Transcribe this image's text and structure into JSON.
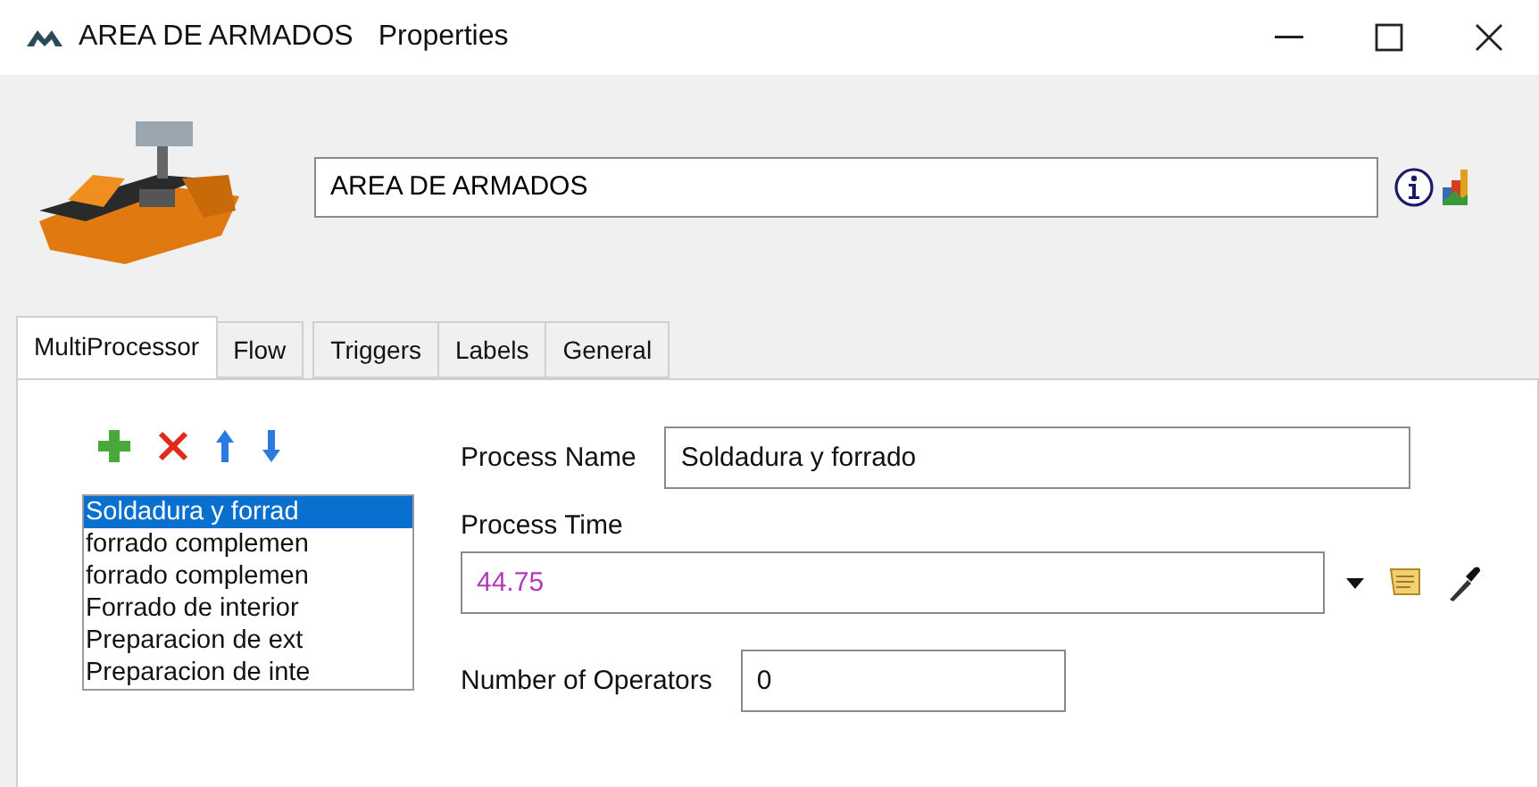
{
  "window": {
    "title": "AREA DE ARMADOS",
    "subtitle": "Properties"
  },
  "object_name": "AREA DE ARMADOS",
  "tabs": [
    {
      "label": "MultiProcessor",
      "selected": true
    },
    {
      "label": "Flow",
      "selected": false
    },
    {
      "label": "Triggers",
      "selected": false
    },
    {
      "label": "Labels",
      "selected": false
    },
    {
      "label": "General",
      "selected": false
    }
  ],
  "processes": [
    {
      "label": "Soldadura y forrad",
      "selected": true
    },
    {
      "label": "forrado complemen",
      "selected": false
    },
    {
      "label": "forrado complemen",
      "selected": false
    },
    {
      "label": "Forrado de interior",
      "selected": false
    },
    {
      "label": "Preparacion de ext",
      "selected": false
    },
    {
      "label": "Preparacion de inte",
      "selected": false
    }
  ],
  "process_name": {
    "label": "Process Name",
    "value": "Soldadura y forrado"
  },
  "process_time": {
    "label": "Process Time",
    "value": "44.75"
  },
  "operators": {
    "label": "Number of Operators",
    "value": "0"
  }
}
